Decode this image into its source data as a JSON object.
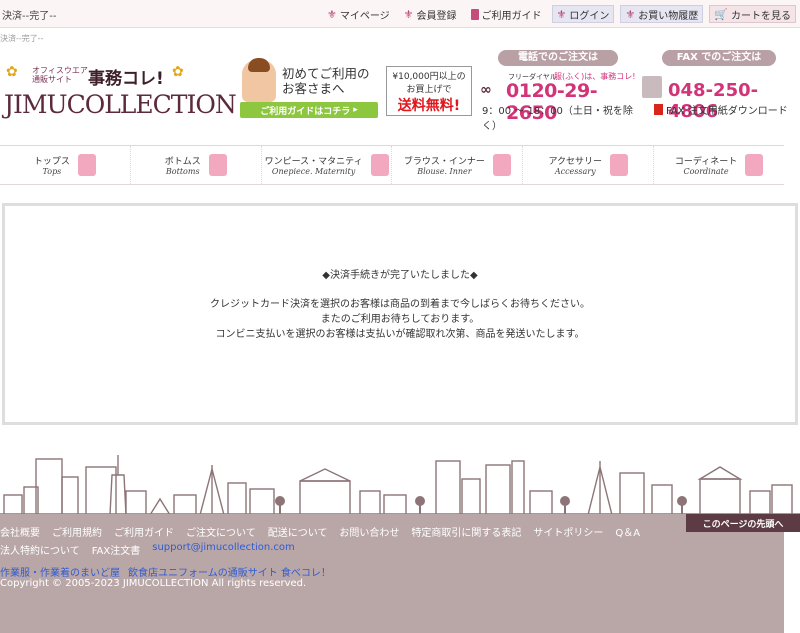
{
  "page_heading": "決済--完了--",
  "sub_heading": "決済--完了--",
  "top_nav": {
    "mypage": "マイページ",
    "register": "会員登録",
    "guide": "ご利用ガイド",
    "login": "ログイン",
    "history": "お買い物履歴",
    "cart": "カートを見る"
  },
  "logo": {
    "tagline_1": "オフィスウエア",
    "tagline_2": "通販サイト",
    "catch": "事務コレ!",
    "brand": "JIMUCOLLECTION"
  },
  "guide_banner": {
    "line1": "初めてご利用の",
    "line2": "お客さまへ",
    "button": "ご利用ガイドはコチラ"
  },
  "free_shipping": {
    "line1": "¥10,000円以上の",
    "line2": "お買上げで",
    "line3": "送料無料!"
  },
  "phone": {
    "title": "電話でのご注文は",
    "freedial": "フリーダイヤル",
    "catch": "服(ふく)は、事務コレ!",
    "number": "0120-29-2650",
    "hours": "9：00 ～ 18：00（土日・祝を除く）"
  },
  "fax": {
    "title": "FAX でのご注文は",
    "number": "048-250-4806",
    "download": "FAX 注文用紙ダウンロード"
  },
  "categories": [
    {
      "jp": "トップス",
      "en": "Tops"
    },
    {
      "jp": "ボトムス",
      "en": "Bottoms"
    },
    {
      "jp": "ワンピース・マタニティ",
      "en": "Onepiece. Maternity"
    },
    {
      "jp": "ブラウス・インナー",
      "en": "Blouse. Inner"
    },
    {
      "jp": "アクセサリー",
      "en": "Accessary"
    },
    {
      "jp": "コーディネート",
      "en": "Coordinate"
    }
  ],
  "main": {
    "title": "◆決済手続きが完了いたしました◆",
    "line1": "クレジットカード決済を選択のお客様は商品の到着まで今しばらくお待ちください。",
    "line2": "またのご利用お待ちしております。",
    "line3": "コンビニ支払いを選択のお客様は支払いが確認取れ次第、商品を発送いたします。"
  },
  "page_top": "このページの先頭へ",
  "footer": {
    "links1": [
      "会社概要",
      "ご利用規約",
      "ご利用ガイド",
      "ご注文について",
      "配送について",
      "お問い合わせ",
      "特定商取引に関する表記",
      "サイトポリシー",
      "Q＆A"
    ],
    "links2": [
      "法人特約について",
      "FAX注文書"
    ],
    "email": "support@jimucollection.com",
    "partner1": "作業服・作業着のまいど屋",
    "partner2": "飲食店ユニフォームの通販サイト 食べコレ！",
    "copyright": "Copyright © 2005-2023 JIMUCOLLECTION All rights reserved."
  },
  "colors": {
    "accent_pink": "#d2347a",
    "footer_bg": "#b9a7a8",
    "skyline": "#8d7478"
  }
}
